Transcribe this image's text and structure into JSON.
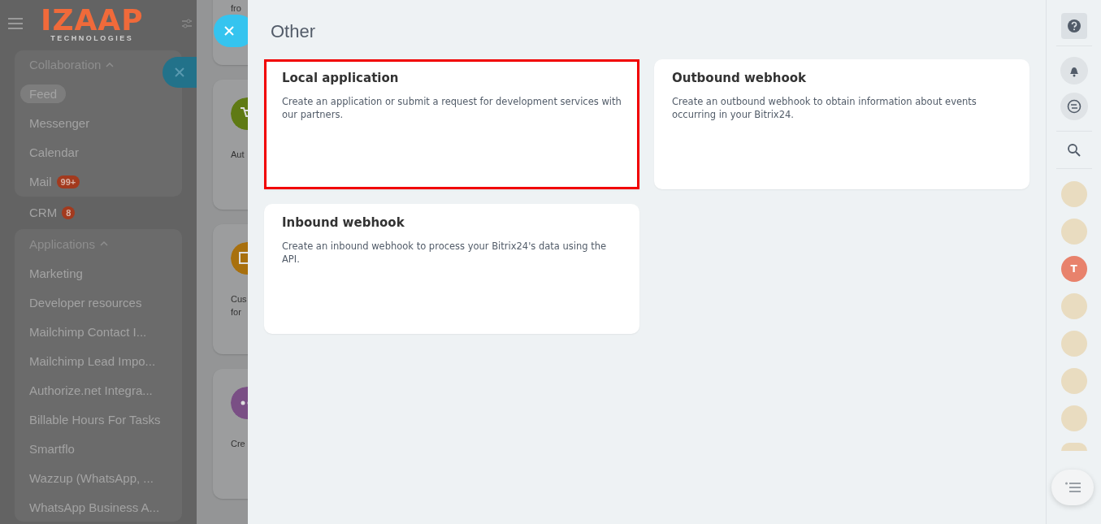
{
  "logo": {
    "name": "IZAAP",
    "tagline": "TECHNOLOGIES"
  },
  "menu": [
    {
      "kind": "group",
      "title": "Collaboration",
      "expanded": true,
      "items": [
        {
          "label": "Feed",
          "selected": true
        },
        {
          "label": "Messenger",
          "selected": false
        },
        {
          "label": "Calendar",
          "selected": false
        },
        {
          "label": "Mail",
          "selected": false,
          "badge": "99+"
        }
      ]
    },
    {
      "kind": "item",
      "label": "CRM",
      "selected": false,
      "badge": "8"
    },
    {
      "kind": "group",
      "title": "Applications",
      "expanded": true,
      "items": [
        {
          "label": "Marketing",
          "selected": false
        },
        {
          "label": "Developer resources",
          "selected": false
        },
        {
          "label": "Mailchimp Contact I...",
          "selected": false
        },
        {
          "label": "Mailchimp Lead Impo...",
          "selected": false
        },
        {
          "label": "Authorize.net Integra...",
          "selected": false
        },
        {
          "label": "Billable Hours For Tasks",
          "selected": false
        },
        {
          "label": "Smartflo",
          "selected": false
        },
        {
          "label": "Wazzup (WhatsApp, ...",
          "selected": false
        },
        {
          "label": "WhatsApp Business A...",
          "selected": false
        }
      ]
    }
  ],
  "back_cards": [
    {
      "kind": "text",
      "lines": [
        "fro"
      ]
    },
    {
      "kind": "cart",
      "color": "#5f7a14",
      "lines": [
        "Aut"
      ]
    },
    {
      "kind": "screen",
      "color": "#a8700e",
      "lines": [
        "Cus",
        "for"
      ]
    },
    {
      "kind": "dots",
      "color": "#7a4f85",
      "lines": [
        "Cre"
      ]
    }
  ],
  "panel": {
    "title": "Other",
    "cards": [
      {
        "title": "Local application",
        "description": "Create an application or submit a request for development services with our partners.",
        "highlighted": true
      },
      {
        "title": "Outbound webhook",
        "description": "Create an outbound webhook to obtain information about events occurring in your Bitrix24.",
        "highlighted": false
      },
      {
        "title": "Inbound webhook",
        "description": "Create an inbound webhook to process your Bitrix24's data using the API.",
        "highlighted": false
      }
    ]
  },
  "right_bar": [
    {
      "kind": "help"
    },
    {
      "kind": "divider"
    },
    {
      "kind": "bell"
    },
    {
      "kind": "chat"
    },
    {
      "kind": "divider"
    },
    {
      "kind": "search"
    },
    {
      "kind": "divider"
    },
    {
      "kind": "avatar"
    },
    {
      "kind": "avatar"
    },
    {
      "kind": "letter",
      "letter": "T",
      "color": "#e8826c"
    },
    {
      "kind": "avatar"
    },
    {
      "kind": "avatar"
    },
    {
      "kind": "avatar"
    },
    {
      "kind": "avatar"
    },
    {
      "kind": "avatar_cut"
    }
  ]
}
